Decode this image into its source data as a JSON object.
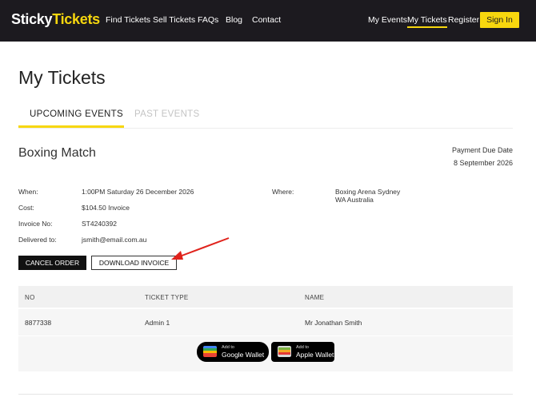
{
  "nav": {
    "logo_part1": "Sticky",
    "logo_part2": "Tickets",
    "links": [
      "Find Tickets",
      "Sell Tickets",
      "FAQs",
      "Blog",
      "Contact"
    ],
    "right_links": [
      "My Events",
      "My Tickets",
      "Register"
    ],
    "active_link": "My Tickets",
    "signin_label": "Sign In"
  },
  "page": {
    "title": "My Tickets",
    "tabs": [
      {
        "label": "UPCOMING EVENTS",
        "active": true
      },
      {
        "label": "PAST EVENTS",
        "active": false
      }
    ]
  },
  "event": {
    "title": "Boxing Match",
    "payment_due_label": "Payment Due Date",
    "payment_due_date": "8 September 2026",
    "details": [
      {
        "label": "When:",
        "value": "1:00PM Saturday 26 December 2026"
      },
      {
        "label": "Cost:",
        "value": "$104.50 Invoice"
      },
      {
        "label": "Invoice No:",
        "value": "ST4240392"
      },
      {
        "label": "Delivered to:",
        "value": "jsmith@email.com.au"
      }
    ],
    "where_label": "Where:",
    "where_line1": "Boxing Arena Sydney",
    "where_line2": "WA Australia",
    "cancel_label": "CANCEL ORDER",
    "download_label": "DOWNLOAD INVOICE"
  },
  "tickets": {
    "columns": [
      "NO",
      "TICKET TYPE",
      "NAME"
    ],
    "rows": [
      {
        "no": "8877338",
        "type": "Admin 1",
        "name": "Mr Jonathan Smith"
      }
    ],
    "google_wallet": {
      "small": "Add to",
      "big": "Google Wallet"
    },
    "apple_wallet": {
      "small": "Add to",
      "big": "Apple Wallet"
    }
  },
  "colors": {
    "nav_bg": "#1c1a1f",
    "accent_yellow": "#f7d70e",
    "annotation_arrow": "#e0231c"
  }
}
